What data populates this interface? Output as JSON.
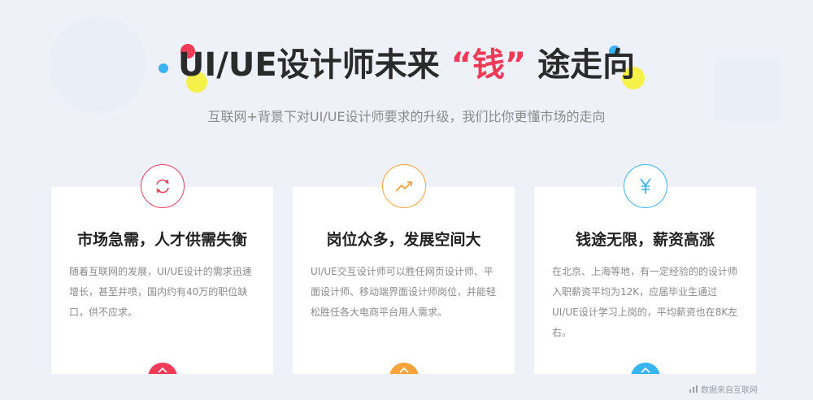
{
  "title": {
    "before": "UI/UE设计师未来",
    "highlight": "“钱”",
    "after": "途走向"
  },
  "subtitle": "互联网+背景下对UI/UE设计师要求的升级，我们比你更懂市场的走向",
  "cards": [
    {
      "icon": "exchange-icon",
      "color": "#ef3b57",
      "title": "市场急需，人才供需失衡",
      "text": "随着互联网的发展，UI/UE设计的需求迅速增长，甚至井喷，国内约有40万的职位缺口，供不应求。"
    },
    {
      "icon": "trend-up-icon",
      "color": "#f7a23b",
      "title": "岗位众多，发展空间大",
      "text": "UI/UE交互设计师可以胜任网页设计师、平面设计师、移动端界面设计师岗位，并能轻松胜任各大电商平台用人需求。"
    },
    {
      "icon": "yen-icon",
      "color": "#39b4f2",
      "title": "钱途无限，薪资高涨",
      "text": "在北京、上海等地，有一定经验的的设计师入职薪资平均为12K，应届毕业生通过UI/UE设计学习上岗的，平均薪资也在8K左右。"
    }
  ],
  "colors": {
    "background": "#eef1f8",
    "accent_red": "#ef3b57",
    "accent_orange": "#f7a23b",
    "accent_blue": "#39b4f2",
    "accent_yellow": "#f5f04a"
  },
  "source": "数据来自互联网"
}
